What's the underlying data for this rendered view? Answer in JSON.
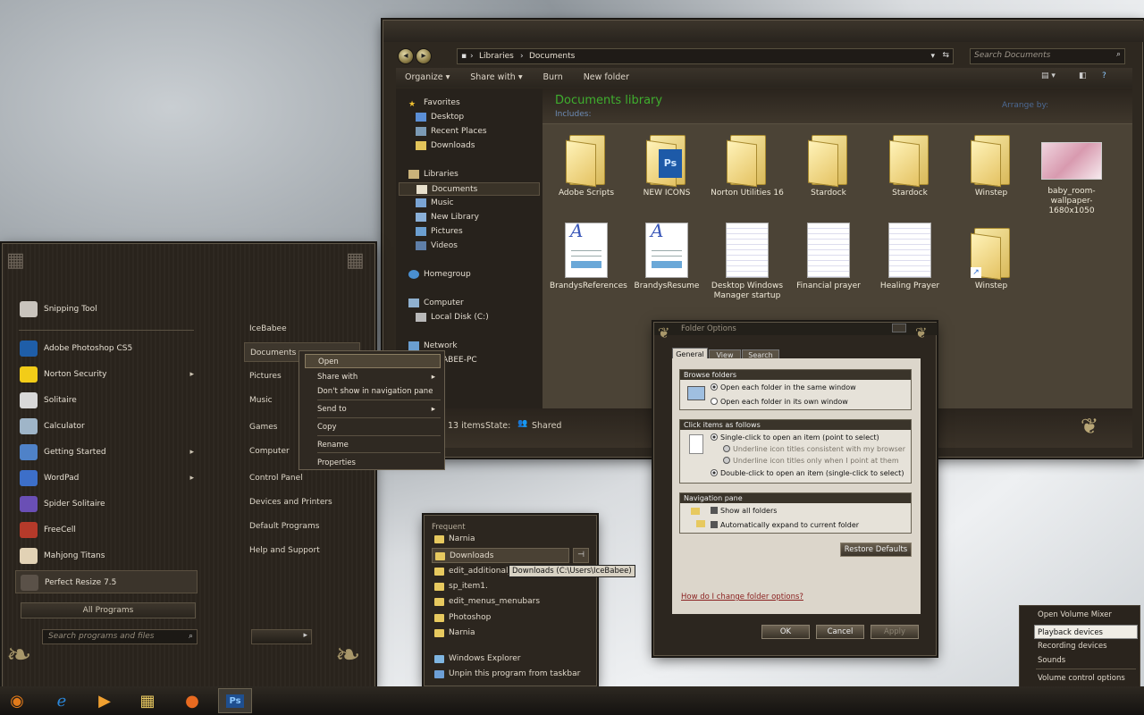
{
  "explorer": {
    "breadcrumb": [
      "Libraries",
      "Documents"
    ],
    "search_placeholder": "Search Documents",
    "toolbar": [
      "Organize",
      "Share with",
      "Burn",
      "New folder"
    ],
    "nav": {
      "favorites": "Favorites",
      "desktop": "Desktop",
      "recent": "Recent Places",
      "downloads": "Downloads",
      "libraries": "Libraries",
      "documents": "Documents",
      "music": "Music",
      "newlib": "New Library",
      "pictures": "Pictures",
      "videos": "Videos",
      "homegroup": "Homegroup",
      "computer": "Computer",
      "localdisk": "Local Disk (C:)",
      "network": "Network",
      "pc": "ABEE-PC"
    },
    "lib_title": "Documents library",
    "lib_sub": "Includes:",
    "arrange": "Arrange by:",
    "items": [
      {
        "label": "Adobe Scripts",
        "kind": "folder"
      },
      {
        "label": "NEW ICONS",
        "kind": "ps-folder"
      },
      {
        "label": "Norton Utilities 16",
        "kind": "folder"
      },
      {
        "label": "Stardock",
        "kind": "folder"
      },
      {
        "label": "Stardock",
        "kind": "folder"
      },
      {
        "label": "Winstep",
        "kind": "folder"
      },
      {
        "label": "baby_room-wallpaper-1680x1050",
        "kind": "image"
      },
      {
        "label": "BrandysReferences",
        "kind": "wordpad"
      },
      {
        "label": "BrandysResume",
        "kind": "wordpad"
      },
      {
        "label": "Desktop Windows Manager startup",
        "kind": "text"
      },
      {
        "label": "Financial prayer",
        "kind": "text"
      },
      {
        "label": "Healing Prayer",
        "kind": "text"
      },
      {
        "label": "Winstep",
        "kind": "folder-shortcut"
      }
    ],
    "status": {
      "count": "13 items",
      "state_label": "State:",
      "state": "Shared"
    }
  },
  "startmenu": {
    "left": [
      {
        "label": "Snipping Tool",
        "color": "#c9c4bd",
        "arrow": ""
      },
      {
        "label": "Adobe Photoshop CS5",
        "color": "#1f5ea8",
        "arrow": ""
      },
      {
        "label": "Norton Security",
        "color": "#f2cc18",
        "arrow": "▸"
      },
      {
        "label": "Solitaire",
        "color": "#d8d8d8",
        "arrow": ""
      },
      {
        "label": "Calculator",
        "color": "#9fb5c8",
        "arrow": ""
      },
      {
        "label": "Getting Started",
        "color": "#4f82c8",
        "arrow": "▸"
      },
      {
        "label": "WordPad",
        "color": "#3d6fc9",
        "arrow": "▸"
      },
      {
        "label": "Spider Solitaire",
        "color": "#6a4fb5",
        "arrow": ""
      },
      {
        "label": "FreeCell",
        "color": "#b53a2a",
        "arrow": ""
      },
      {
        "label": "Mahjong Titans",
        "color": "#e2d2b5",
        "arrow": ""
      },
      {
        "label": "Perfect Resize 7.5",
        "color": "#5a5148",
        "arrow": ""
      }
    ],
    "all_programs": "All Programs",
    "search_placeholder": "Search programs and files",
    "right": [
      "IceBabee",
      "Documents",
      "Pictures",
      "Music",
      "Games",
      "Computer",
      "Control Panel",
      "Devices and Printers",
      "Default Programs",
      "Help and Support"
    ]
  },
  "context": [
    "Open",
    "Share with",
    "Don't show in navigation pane",
    "Send to",
    "Copy",
    "Rename",
    "Properties"
  ],
  "folderoptions": {
    "title": "Folder Options",
    "tabs": [
      "General",
      "View",
      "Search"
    ],
    "browse": {
      "title": "Browse folders",
      "opt1": "Open each folder in the same window",
      "opt2": "Open each folder in its own window"
    },
    "click": {
      "title": "Click items as follows",
      "opt1": "Single-click to open an item (point to select)",
      "sub1": "Underline icon titles consistent with my browser",
      "sub2": "Underline icon titles only when I point at them",
      "opt2": "Double-click to open an item (single-click to select)"
    },
    "navpane": {
      "title": "Navigation pane",
      "opt1": "Show all folders",
      "opt2": "Automatically expand to current folder"
    },
    "restore": "Restore Defaults",
    "help": "How do I change folder options?",
    "ok": "OK",
    "cancel": "Cancel",
    "apply": "Apply"
  },
  "jumplist": {
    "header": "Frequent",
    "items": [
      "Narnia",
      "Downloads",
      "edit_additional_p",
      "sp_item1.",
      "edit_menus_menubars",
      "Photoshop",
      "Narnia"
    ],
    "tooltip": "Downloads (C:\\Users\\IceBabee)",
    "explorer": "Windows Explorer",
    "unpin": "Unpin this program from taskbar"
  },
  "volume": [
    "Open Volume Mixer",
    "Playback devices",
    "Recording devices",
    "Sounds",
    "Volume control options"
  ],
  "colors": {
    "accent_green": "#3fae2e",
    "highlight": "#5a5040"
  }
}
